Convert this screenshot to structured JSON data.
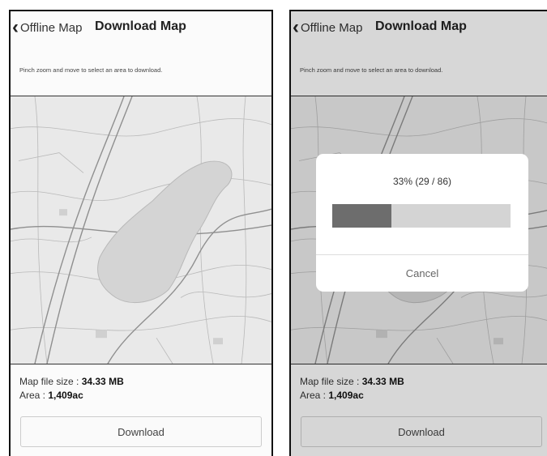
{
  "screens": [
    {
      "header": {
        "back_label": "Offline Map",
        "title": "Download Map"
      },
      "instruction": "Pinch zoom and move to select an area to download.",
      "map_file_size": {
        "label": "Map file size : ",
        "value": "34.33 MB"
      },
      "area": {
        "label": "Area : ",
        "value": "1,409ac"
      },
      "download_label": "Download"
    },
    {
      "header": {
        "back_label": "Offline Map",
        "title": "Download Map"
      },
      "instruction": "Pinch zoom and move to select an area to download.",
      "map_file_size": {
        "label": "Map file size : ",
        "value": "34.33 MB"
      },
      "area": {
        "label": "Area : ",
        "value": "1,409ac"
      },
      "download_label": "Download",
      "progress_dialog": {
        "text": "33% (29 / 86)",
        "progress": 0.33,
        "cancel_label": "Cancel"
      }
    }
  ],
  "icons": {
    "back": "chevron-left-icon"
  },
  "colors": {
    "map_background": "#e9e9e9",
    "lake": "#d4d4d4",
    "progress_fill": "#6d6d6d",
    "progress_track": "#d4d4d4"
  }
}
